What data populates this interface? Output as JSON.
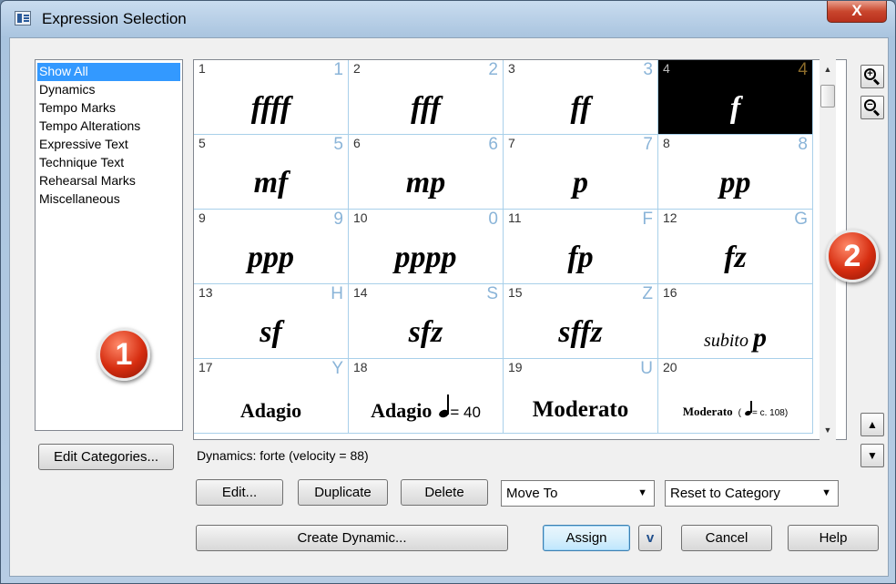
{
  "window": {
    "title": "Expression Selection",
    "close_label": "X"
  },
  "categories": {
    "items": [
      {
        "label": "Show All",
        "selected": true
      },
      {
        "label": "Dynamics",
        "selected": false
      },
      {
        "label": "Tempo Marks",
        "selected": false
      },
      {
        "label": "Tempo Alterations",
        "selected": false
      },
      {
        "label": "Expressive Text",
        "selected": false
      },
      {
        "label": "Technique Text",
        "selected": false
      },
      {
        "label": "Rehearsal Marks",
        "selected": false
      },
      {
        "label": "Miscellaneous",
        "selected": false
      }
    ]
  },
  "badges": {
    "one": "1",
    "two": "2"
  },
  "cells": [
    {
      "num": "1",
      "key": "1",
      "mark": "ffff"
    },
    {
      "num": "2",
      "key": "2",
      "mark": "fff"
    },
    {
      "num": "3",
      "key": "3",
      "mark": "ff"
    },
    {
      "num": "4",
      "key": "4",
      "mark": "f",
      "selected": true
    },
    {
      "num": "5",
      "key": "5",
      "mark": "mf"
    },
    {
      "num": "6",
      "key": "6",
      "mark": "mp"
    },
    {
      "num": "7",
      "key": "7",
      "mark": "p"
    },
    {
      "num": "8",
      "key": "8",
      "mark": "pp"
    },
    {
      "num": "9",
      "key": "9",
      "mark": "ppp"
    },
    {
      "num": "10",
      "key": "0",
      "mark": "pppp"
    },
    {
      "num": "11",
      "key": "F",
      "mark": "fp"
    },
    {
      "num": "12",
      "key": "G",
      "mark": "fz"
    },
    {
      "num": "13",
      "key": "H",
      "mark": "sf"
    },
    {
      "num": "14",
      "key": "S",
      "mark": "sfz"
    },
    {
      "num": "15",
      "key": "Z",
      "mark": "sffz"
    },
    {
      "num": "16",
      "key": "",
      "mark_pre": "subito",
      "mark_main": "p"
    },
    {
      "num": "17",
      "key": "Y",
      "mark": "Adagio"
    },
    {
      "num": "18",
      "key": "",
      "mark": "Adagio",
      "tempo": "= 40"
    },
    {
      "num": "19",
      "key": "U",
      "mark": "Moderato"
    },
    {
      "num": "20",
      "key": "",
      "mark": "Moderato",
      "tempo_pre": "(",
      "tempo": "= c. 108)"
    }
  ],
  "buttons": {
    "edit_categories": "Edit Categories...",
    "edit": "Edit...",
    "duplicate": "Duplicate",
    "delete": "Delete",
    "create_dynamic": "Create Dynamic...",
    "assign": "Assign",
    "assign_dropdown": "v",
    "cancel": "Cancel",
    "help": "Help"
  },
  "combos": {
    "move_to": "Move To",
    "reset_to_category": "Reset to Category"
  },
  "status": "Dynamics: forte (velocity = 88)",
  "scroll": {
    "up": "▲",
    "down": "▼"
  },
  "toolbar": {
    "zoom_in": "+",
    "zoom_out": "−",
    "move_up": "▲",
    "move_down": "▼"
  }
}
